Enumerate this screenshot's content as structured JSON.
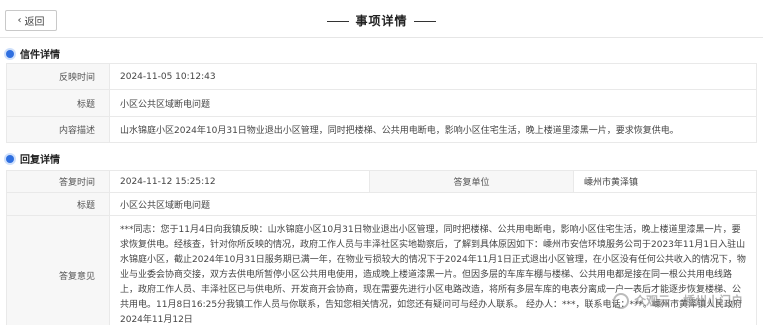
{
  "back_button": {
    "label": "返回"
  },
  "page_title": "事项详情",
  "letter_section": {
    "heading": "信件详情",
    "rows": [
      {
        "label": "反映时间",
        "value": "2024-11-05 10:12:43"
      },
      {
        "label": "标题",
        "value": "小区公共区域断电问题"
      },
      {
        "label": "内容描述",
        "value": "山水锦庭小区2024年10月31日物业退出小区管理，同时把楼梯、公共用电断电，影响小区住宅生活，晚上楼道里漆黑一片，要求恢复供电。"
      }
    ]
  },
  "reply_section": {
    "heading": "回复详情",
    "reply_time_label": "答复时间",
    "reply_time": "2024-11-12 15:25:12",
    "reply_unit_label": "答复单位",
    "reply_unit": "嵊州市黄泽镇",
    "title_label": "标题",
    "title": "小区公共区域断电问题",
    "opinion_label": "答复意见",
    "opinion": "***同志：您于11月4日向我镇反映：山水锦庭小区10月31日物业退出小区管理，同时把楼梯、公共用电断电，影响小区住宅生活，晚上楼道里漆黑一片，要求恢复供电。经核查，针对你所反映的情况，政府工作人员与丰泽社区实地勘察后，了解到具体原因如下：嵊州市安信环境服务公司于2023年11月1日入驻山水锦庭小区，截止2024年10月31日服务期已满一年，在物业亏损较大的情况下于2024年11月1日正式退出小区管理，在小区没有任何公共收入的情况下，物业与业委会协商交接，双方去供电所暂停小区公共用电使用，造成晚上楼道漆黑一片。但因多层的车库车棚与楼梯、公共用电都是接在同一根公共用电线路上，政府工作人员、丰泽社区已与供电所、开发商开会协商，现在需要先进行小区电路改造，将所有多层车库的电表分离成一户一表后才能逐步恢复楼梯、公共用电。11月8日16:25分我镇工作人员与你联系，告知您相关情况，如您还有疑问可与经办人联系。 经办人：***，联系电话：***。嵊州市黄泽镇人民政府 2024年11月12日"
  },
  "watermark": "众观云 · 嵊州小门户"
}
